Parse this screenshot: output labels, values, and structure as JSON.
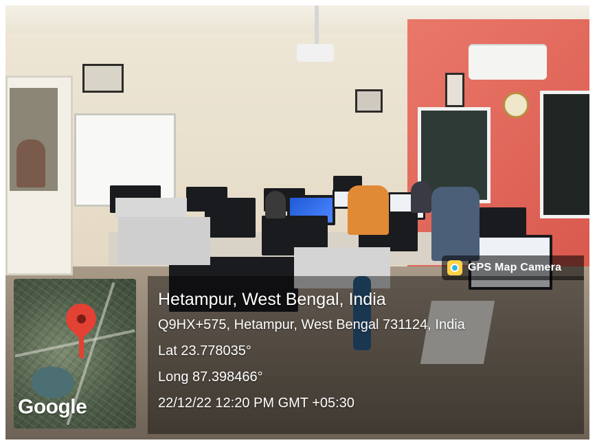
{
  "badge": {
    "app_name": "GPS Map Camera",
    "icon": "gps-map-camera-icon"
  },
  "location": {
    "place": "Hetampur, West Bengal, India",
    "address": "Q9HX+575, Hetampur, West Bengal 731124, India",
    "latitude": "Lat 23.778035°",
    "longitude": "Long 87.398466°",
    "datetime": "22/12/22 12:20 PM GMT +05:30"
  },
  "map": {
    "provider_label": "Google",
    "marker_icon": "map-pin-icon"
  },
  "colors": {
    "pin": "#e34133",
    "overlay_text": "#ffffff"
  }
}
